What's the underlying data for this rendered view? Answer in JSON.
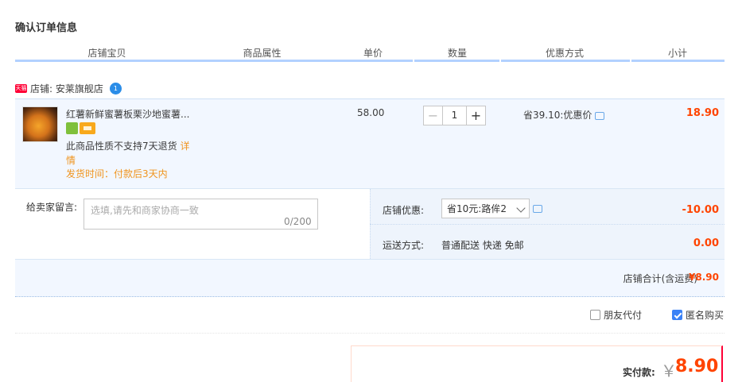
{
  "title": "确认订单信息",
  "columns": [
    "店铺宝贝",
    "商品属性",
    "单价",
    "数量",
    "优惠方式",
    "小计"
  ],
  "shop": {
    "badge": "天猫",
    "label": "店铺: 安莱旗舰店",
    "ww_badge": "1"
  },
  "item": {
    "title": "红薯新鲜蜜薯板栗沙地蜜薯...",
    "notice_text": "此商品性质不支持7天退货",
    "notice_link": "详情",
    "ship_time": "发货时间：付款后3天内",
    "price": "58.00",
    "quantity": "1",
    "discount": "省39.10:优惠价",
    "subtotal": "18.90"
  },
  "message": {
    "label": "给卖家留言:",
    "placeholder": "选填,请先和商家协商一致",
    "count": "0/200"
  },
  "shop_discount": {
    "label": "店铺优惠:",
    "selected": "省10元:路侔2",
    "value": "-10.00"
  },
  "shipping": {
    "label": "运送方式:",
    "method": "普通配送 快递 免邮",
    "fee": "0.00"
  },
  "shop_total": {
    "label": "店铺合计(含运费)",
    "value": "¥8.90"
  },
  "options": {
    "friend_pay": "朋友代付",
    "anonymous": "匿名购买"
  },
  "payment": {
    "label": "实付款:",
    "currency": "￥",
    "amount": "8.90"
  },
  "colors": {
    "accent": "#ff4400",
    "header_line": "#b2d1ff",
    "row_bg": "#f2f7ff",
    "link": "#f0941e"
  }
}
